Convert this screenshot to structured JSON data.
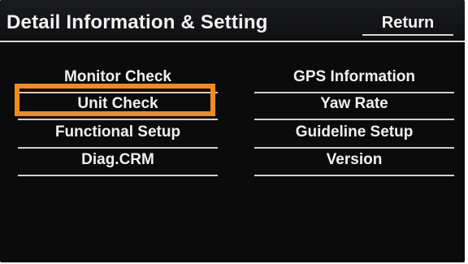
{
  "header": {
    "title": "Detail Information & Setting",
    "return_label": "Return"
  },
  "menu": {
    "left": [
      {
        "label": "Monitor Check"
      },
      {
        "label": "Unit Check"
      },
      {
        "label": "Functional Setup"
      },
      {
        "label": "Diag.CRM"
      }
    ],
    "right": [
      {
        "label": "GPS Information"
      },
      {
        "label": "Yaw Rate"
      },
      {
        "label": "Guideline Setup"
      },
      {
        "label": "Version"
      }
    ]
  },
  "highlight": {
    "target": "Unit Check",
    "color": "#f28b1d"
  },
  "colors": {
    "background": "#0b0b0c",
    "text": "#f0f0f0",
    "divider": "#cfcfcf"
  }
}
